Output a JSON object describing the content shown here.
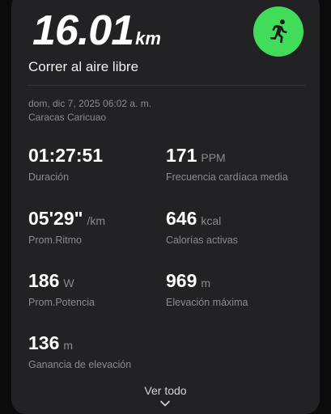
{
  "summary": {
    "distance_value": "16.01",
    "distance_unit": "km",
    "activity_type": "Correr al aire libre",
    "date_time": "dom, dic 7, 2025 06:02 a. m.",
    "location": "Caracas Caricuao"
  },
  "icons": {
    "activity_badge": "running-person-icon",
    "see_all_chevron": "chevron-down-icon",
    "badge_color": "#41dc5a"
  },
  "stats": [
    {
      "value": "01:27:51",
      "unit": "",
      "label": "Duración"
    },
    {
      "value": "171",
      "unit": "PPM",
      "label": "Frecuencia cardíaca media"
    },
    {
      "value": "05'29\"",
      "unit": "/km",
      "label": "Prom.Ritmo"
    },
    {
      "value": "646",
      "unit": "kcal",
      "label": "Calorías activas"
    },
    {
      "value": "186",
      "unit": "W",
      "label": "Prom.Potencia"
    },
    {
      "value": "969",
      "unit": "m",
      "label": "Elevación máxima"
    },
    {
      "value": "136",
      "unit": "m",
      "label": "Ganancia de elevación"
    }
  ],
  "footer": {
    "see_all_label": "Ver todo"
  }
}
